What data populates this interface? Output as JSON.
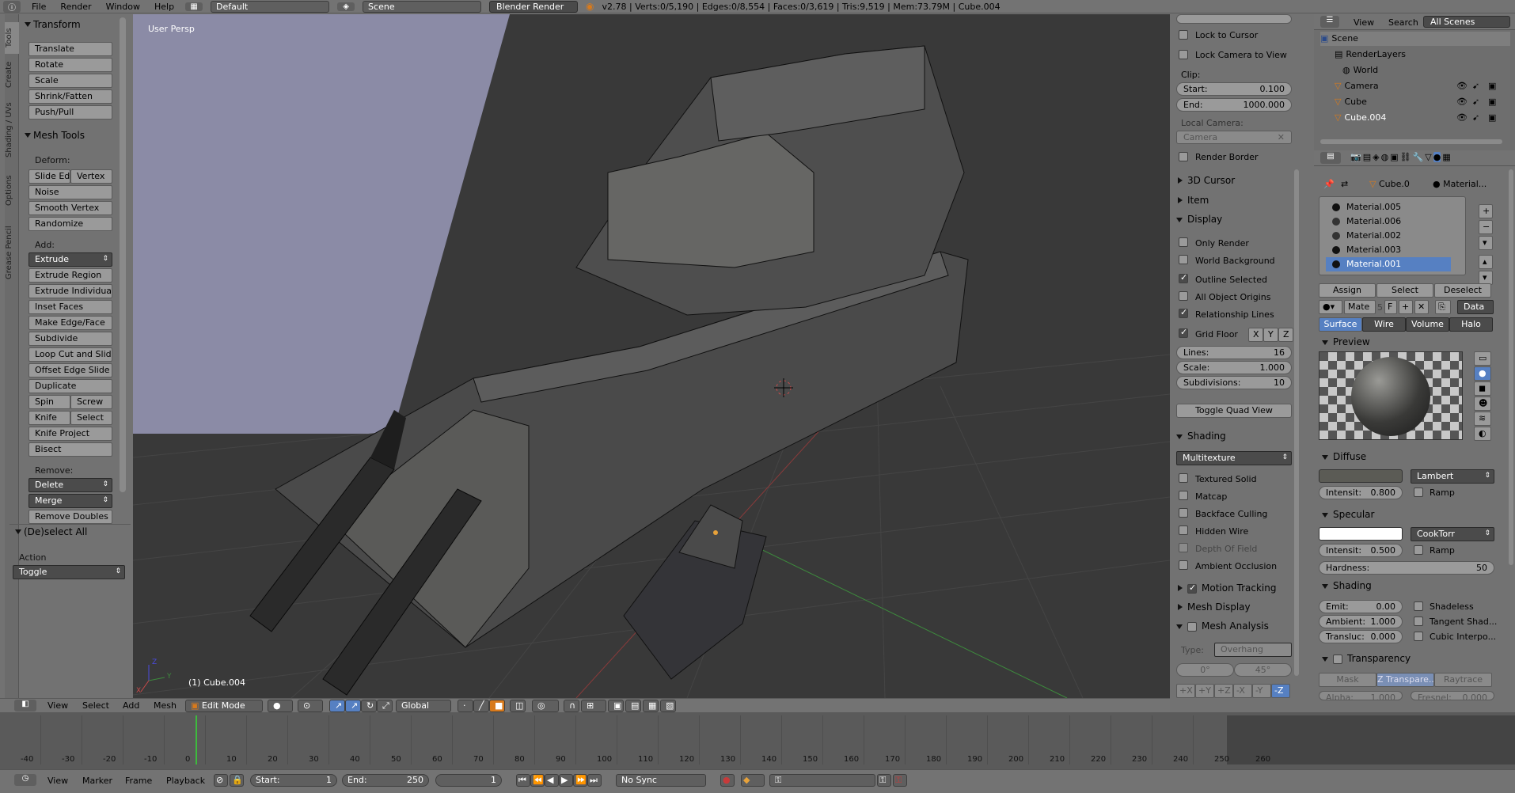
{
  "menu": {
    "items": [
      "File",
      "Render",
      "Window",
      "Help"
    ],
    "layout": "Default",
    "scene": "Scene",
    "engine": "Blender Render",
    "info": "v2.78 | Verts:0/5,190 | Edges:0/8,554 | Faces:0/3,619 | Tris:9,519 | Mem:73.79M | Cube.004"
  },
  "toolshelf": {
    "tabs": [
      "Tools",
      "Create",
      "Shading / UVs",
      "Options",
      "Grease Pencil"
    ],
    "transform": {
      "title": "Transform",
      "buttons": [
        "Translate",
        "Rotate",
        "Scale",
        "Shrink/Fatten",
        "Push/Pull"
      ]
    },
    "mesh_tools": {
      "title": "Mesh Tools",
      "deform_label": "Deform:",
      "slide_edge": "Slide Ed",
      "vertex": "Vertex",
      "noise": "Noise",
      "smooth_vertex": "Smooth Vertex",
      "randomize": "Randomize",
      "add_label": "Add:",
      "extrude": "Extrude",
      "extrude_region": "Extrude Region",
      "extrude_individual": "Extrude Individual",
      "inset_faces": "Inset Faces",
      "make_edge_face": "Make Edge/Face",
      "subdivide": "Subdivide",
      "loop_cut": "Loop Cut and Slide",
      "offset_edge": "Offset Edge Slide",
      "duplicate": "Duplicate",
      "spin": "Spin",
      "screw": "Screw",
      "knife": "Knife",
      "select": "Select",
      "knife_project": "Knife Project",
      "bisect": "Bisect",
      "remove_label": "Remove:",
      "delete": "Delete",
      "merge": "Merge",
      "remove_doubles": "Remove Doubles"
    },
    "deselect_all": {
      "title": "(De)select All",
      "action_label": "Action",
      "action_value": "Toggle"
    }
  },
  "viewport": {
    "mode_label": "User Persp",
    "object_label": "(1) Cube.004",
    "axis_labels": [
      "Z",
      "Y",
      "X"
    ],
    "colors": {
      "bg": "#393939",
      "grid": "#454545",
      "red_axis": "#8a3a3a",
      "green_axis": "#3d8a3d",
      "sky": "#8b8ba6"
    }
  },
  "npanel": {
    "lock_cursor": "Lock to Cursor",
    "lock_camera": "Lock Camera to View",
    "clip_label": "Clip:",
    "clip_start_label": "Start:",
    "clip_start": "0.100",
    "clip_end_label": "End:",
    "clip_end": "1000.000",
    "local_camera_label": "Local Camera:",
    "local_camera": "Camera",
    "render_border": "Render Border",
    "cursor_3d": "3D Cursor",
    "item": "Item",
    "display": "Display",
    "only_render": "Only Render",
    "world_background": "World Background",
    "outline_selected": "Outline Selected",
    "all_object_origins": "All Object Origins",
    "relationship_lines": "Relationship Lines",
    "grid_floor": "Grid Floor",
    "axes": [
      "X",
      "Y",
      "Z"
    ],
    "lines_label": "Lines:",
    "lines": "16",
    "scale_label": "Scale:",
    "scale": "1.000",
    "subdivisions_label": "Subdivisions:",
    "subdivisions": "10",
    "toggle_quad": "Toggle Quad View",
    "shading": "Shading",
    "shading_mode": "Multitexture",
    "textured_solid": "Textured Solid",
    "matcap": "Matcap",
    "backface_culling": "Backface Culling",
    "hidden_wire": "Hidden Wire",
    "depth_of_field": "Depth Of Field",
    "ambient_occlusion": "Ambient Occlusion",
    "motion_tracking": "Motion Tracking",
    "mesh_display": "Mesh Display",
    "mesh_analysis": "Mesh Analysis",
    "type_label": "Type:",
    "type_value": "Overhang",
    "angle_min": "0°",
    "angle_max": "45°",
    "axis_buttons": [
      "+X",
      "+Y",
      "+Z",
      "-X",
      "-Y",
      "-Z"
    ]
  },
  "outliner": {
    "menus": [
      "View",
      "Search"
    ],
    "filter": "All Scenes",
    "items": [
      "Scene",
      "RenderLayers",
      "World",
      "Camera",
      "Cube",
      "Cube.004"
    ]
  },
  "properties": {
    "breadcrumb_object": "Cube.0",
    "breadcrumb_material": "Material...",
    "materials": [
      "Material.005",
      "Material.006",
      "Material.002",
      "Material.003",
      "Material.001"
    ],
    "assign": "Assign",
    "select": "Select",
    "deselect": "Deselect",
    "mat_name": "Mate",
    "users": "5",
    "fake": "F",
    "data": "Data",
    "tabs": [
      "Surface",
      "Wire",
      "Volume",
      "Halo"
    ],
    "preview": "Preview",
    "diffuse": "Diffuse",
    "diffuse_shader": "Lambert",
    "diffuse_intensity_label": "Intensit:",
    "diffuse_intensity": "0.800",
    "ramp": "Ramp",
    "specular": "Specular",
    "specular_shader": "CookTorr",
    "specular_intensity_label": "Intensit:",
    "specular_intensity": "0.500",
    "hardness_label": "Hardness:",
    "hardness": "50",
    "shading": "Shading",
    "emit_label": "Emit:",
    "emit": "0.00",
    "ambient_label": "Ambient:",
    "ambient": "1.000",
    "transluc_label": "Transluc:",
    "transluc": "0.000",
    "shadeless": "Shadeless",
    "tangent_shading": "Tangent Shad...",
    "cubic_interp": "Cubic Interpo...",
    "transparency": "Transparency",
    "mask": "Mask",
    "z_transparency": "Z Transpare...",
    "raytrace": "Raytrace",
    "alpha_label": "Alpha:",
    "alpha": "1.000",
    "fresnel_label": "Fresnel:",
    "fresnel": "0.000",
    "colors": {
      "selected": "#5680c2",
      "tab_active": "#5680c2"
    }
  },
  "view3d_header": {
    "menus": [
      "View",
      "Select",
      "Add",
      "Mesh"
    ],
    "mode": "Edit Mode",
    "orientation": "Global"
  },
  "timeline": {
    "ticks": [
      "-40",
      "-30",
      "-20",
      "-10",
      "0",
      "10",
      "20",
      "30",
      "40",
      "50",
      "60",
      "70",
      "80",
      "90",
      "100",
      "110",
      "120",
      "130",
      "140",
      "150",
      "160",
      "170",
      "180",
      "190",
      "200",
      "210",
      "220",
      "230",
      "240",
      "250",
      "260"
    ],
    "current_frame": "1",
    "menus": [
      "View",
      "Marker",
      "Frame",
      "Playback"
    ],
    "start_label": "Start:",
    "start": "1",
    "end_label": "End:",
    "end": "250",
    "sync": "No Sync"
  }
}
